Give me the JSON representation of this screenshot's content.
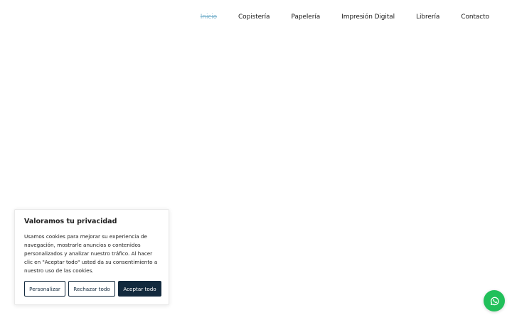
{
  "nav": {
    "items": [
      {
        "label": "Inicio",
        "active": true
      },
      {
        "label": "Copistería",
        "active": false
      },
      {
        "label": "Papelería",
        "active": false
      },
      {
        "label": "Impresión Digital",
        "active": false
      },
      {
        "label": "Librería",
        "active": false
      },
      {
        "label": "Contacto",
        "active": false
      }
    ]
  },
  "cookie_banner": {
    "title": "Valoramos tu privacidad",
    "body": "Usamos cookies para mejorar su experiencia de navegación, mostrarle anuncios o contenidos personalizados y analizar nuestro tráfico. Al hacer clic en \"Aceptar todo\" usted da su consentimiento a nuestro uso de las cookies.",
    "buttons": {
      "customize": "Personalizar",
      "reject": "Rechazar todo",
      "accept": "Aceptar todo"
    }
  },
  "floating": {
    "whatsapp_icon": "whatsapp-icon"
  },
  "colors": {
    "nav_active": "#7fb6cf",
    "button_dark": "#12293d",
    "whatsapp_green": "#21c05a"
  }
}
